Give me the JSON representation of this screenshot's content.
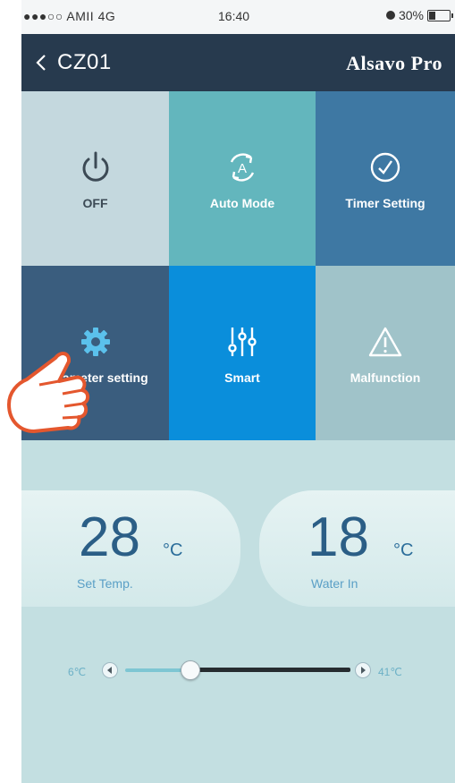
{
  "status_bar": {
    "carrier": "●●●○○ AMII 4G",
    "time": "16:40",
    "battery": "30%",
    "battery_level": 0.3
  },
  "nav": {
    "back_icon": "chevron-left-icon",
    "device_name": "CZ01",
    "brand": "Alsavo Pro"
  },
  "tiles": [
    {
      "label": "OFF",
      "icon": "power-icon",
      "color": "#c4d8de"
    },
    {
      "label": "Auto Mode",
      "icon": "auto-mode-icon",
      "color": "#63b6bd"
    },
    {
      "label": "Timer Setting",
      "icon": "clock-icon",
      "color": "#3e78a3"
    },
    {
      "label": "Parameter setting",
      "icon": "gear-icon",
      "color": "#3a5d7e"
    },
    {
      "label": "Smart",
      "icon": "sliders-icon",
      "color": "#0a8edb"
    },
    {
      "label": "Malfunction",
      "icon": "warning-icon",
      "color": "#a0c3c9"
    }
  ],
  "temps": {
    "set_temp": {
      "value": "28",
      "unit": "°C",
      "label": "Set Temp."
    },
    "water_in": {
      "value": "18",
      "unit": "°C",
      "label": "Water In"
    }
  },
  "slider": {
    "min_label": "6℃",
    "max_label": "41℃",
    "min": 6,
    "max": 41,
    "value": 16
  },
  "colors": {
    "background": "#c3dfe1",
    "navbar": "#273a4e",
    "accent": "#0a8edb",
    "temp_text": "#2b5e86"
  }
}
